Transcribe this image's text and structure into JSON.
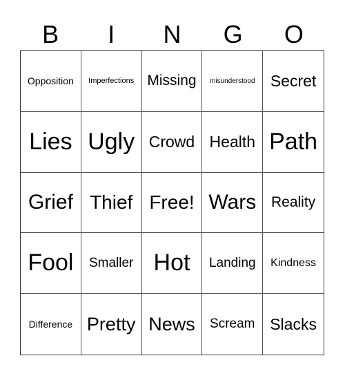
{
  "header": {
    "letters": [
      "B",
      "I",
      "N",
      "G",
      "O"
    ]
  },
  "board": {
    "rows": [
      [
        "Opposition",
        "Imperfections",
        "Missing",
        "misunderstood",
        "Secret"
      ],
      [
        "Lies",
        "Ugly",
        "Crowd",
        "Health",
        "Path"
      ],
      [
        "Grief",
        "Thief",
        "Free!",
        "Wars",
        "Reality"
      ],
      [
        "Fool",
        "Smaller",
        "Hot",
        "Landing",
        "Kindness"
      ],
      [
        "Difference",
        "Pretty",
        "News",
        "Scream",
        "Slacks"
      ]
    ]
  }
}
